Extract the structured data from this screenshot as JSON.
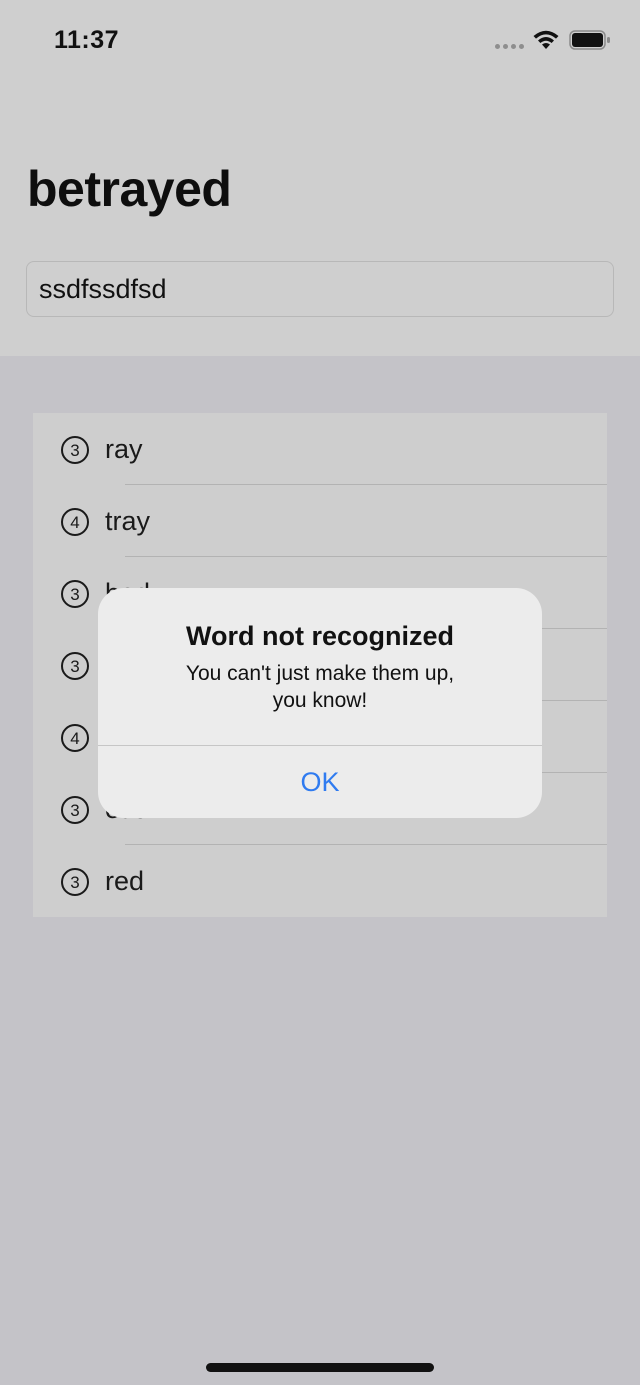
{
  "status_bar": {
    "time": "11:37"
  },
  "header": {
    "title": "betrayed",
    "input_value": "ssdfssdfsd"
  },
  "words": [
    {
      "count": "3",
      "word": "ray"
    },
    {
      "count": "4",
      "word": "tray"
    },
    {
      "count": "3",
      "word": "bed"
    },
    {
      "count": "3",
      "word": ""
    },
    {
      "count": "4",
      "word": ""
    },
    {
      "count": "3",
      "word": "eat"
    },
    {
      "count": "3",
      "word": "red"
    }
  ],
  "alert": {
    "title": "Word not recognized",
    "message_line1": "You can't just make them up,",
    "message_line2": "you know!",
    "ok_label": "OK"
  },
  "colors": {
    "accent": "#2f7bf0"
  }
}
